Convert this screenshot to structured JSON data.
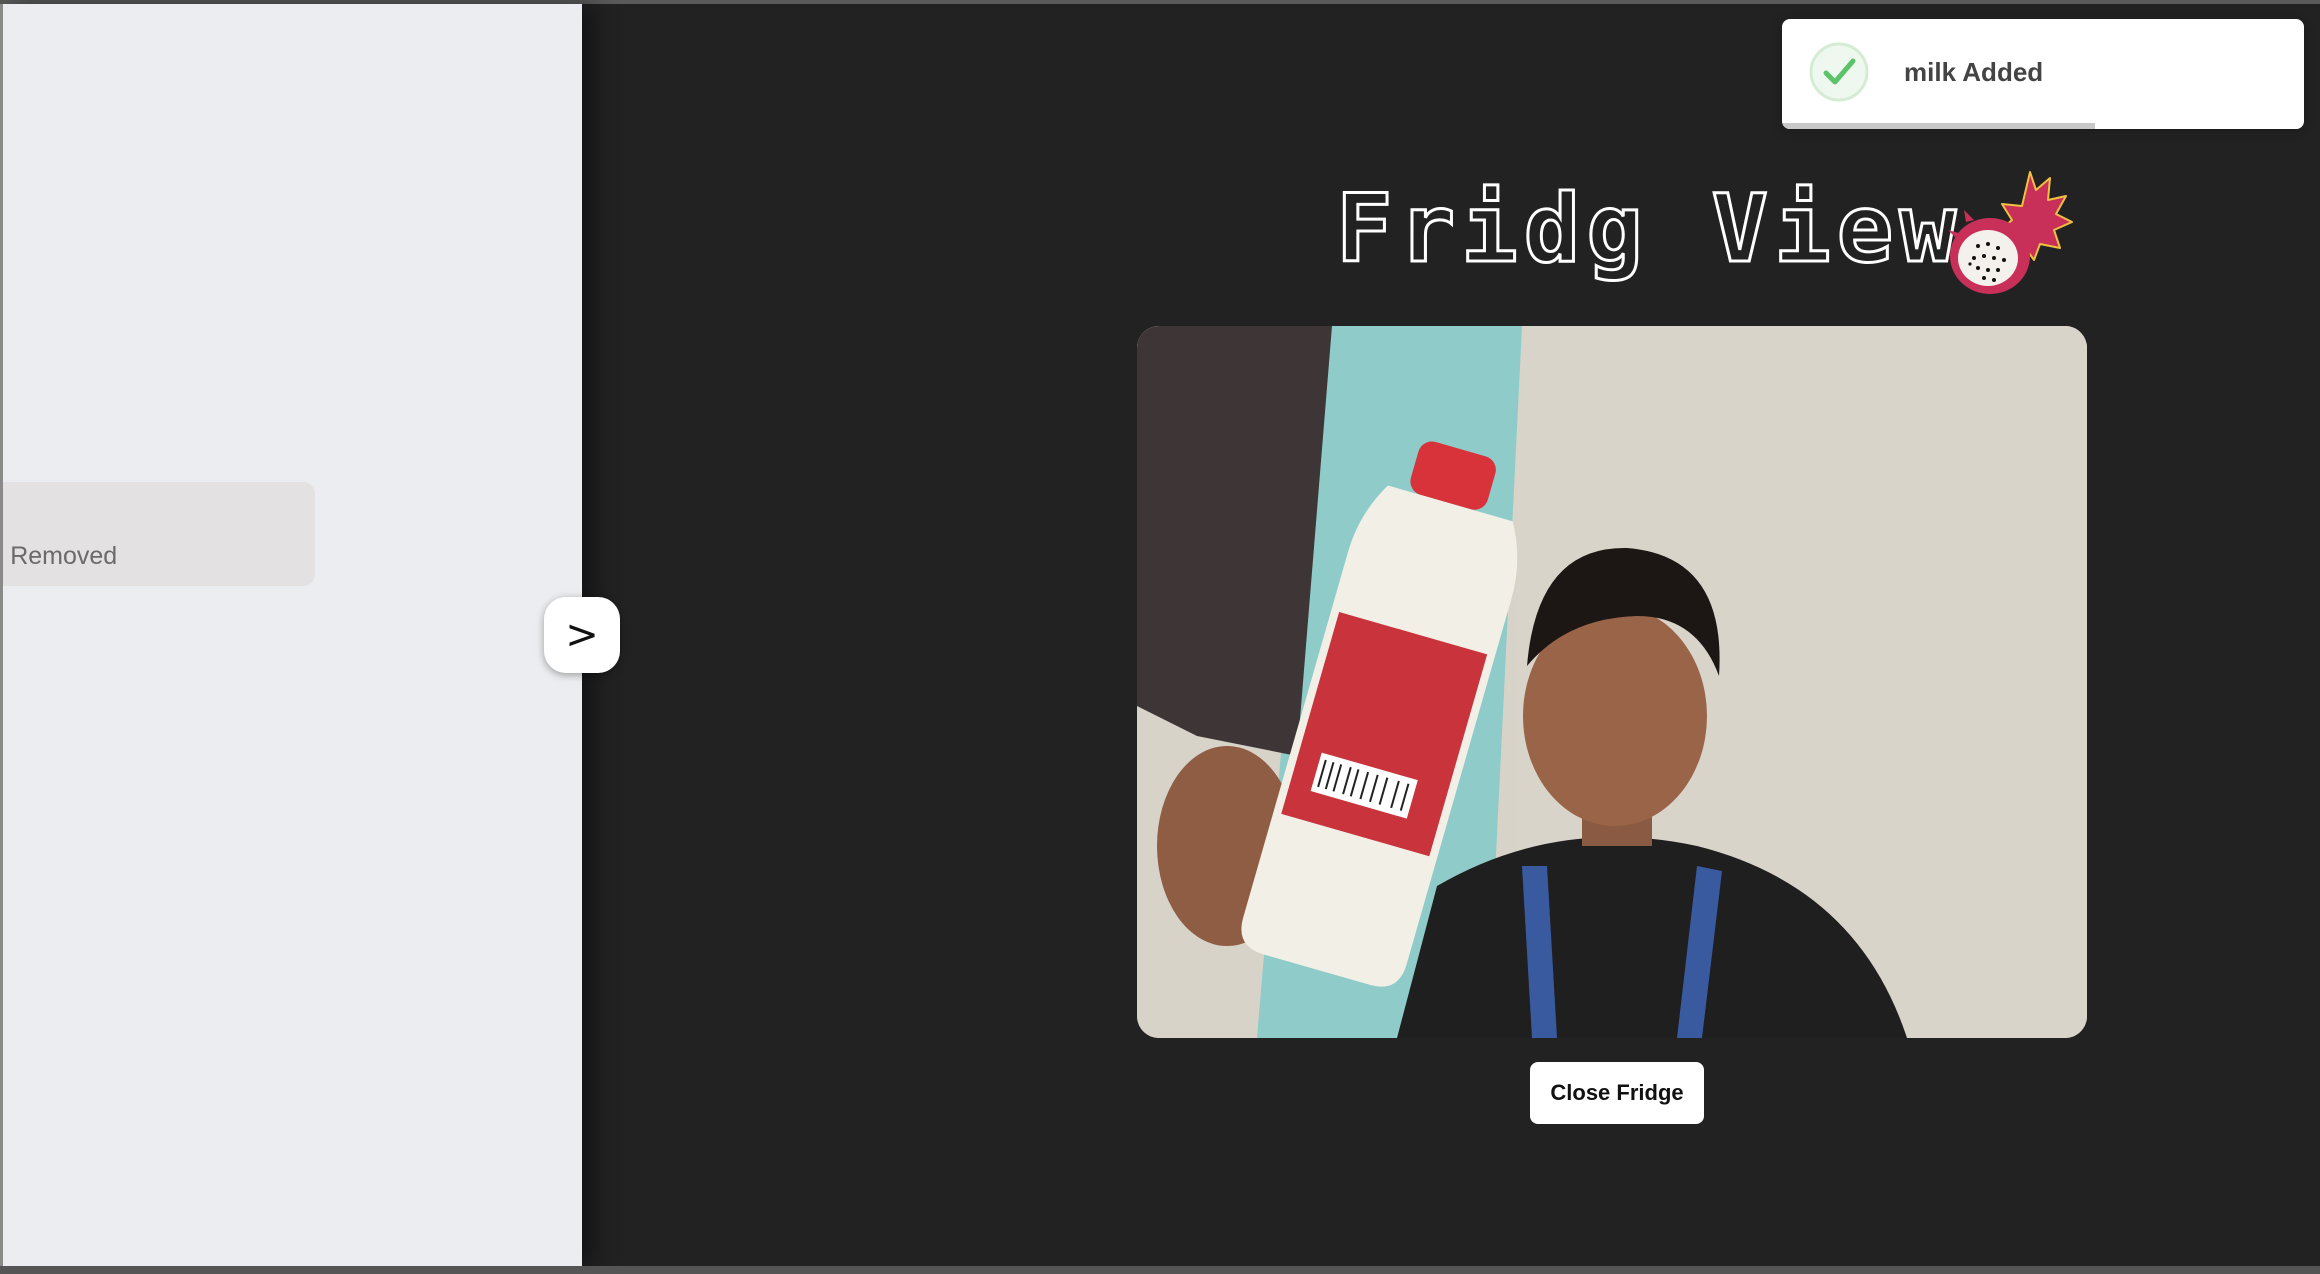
{
  "sidebar": {
    "history_item_text": "ys - Removed",
    "toggle_label": ">"
  },
  "main": {
    "title": "Fridg View",
    "close_button_label": "Close Fridge"
  },
  "toast": {
    "message": "milk Added",
    "icon": "check-circle-icon",
    "progress": 0.6
  },
  "colors": {
    "background": "#222222",
    "sidebar": "#ecedf0",
    "toast_success": "#5bc36a",
    "fruit_accent": "#c8305a"
  }
}
